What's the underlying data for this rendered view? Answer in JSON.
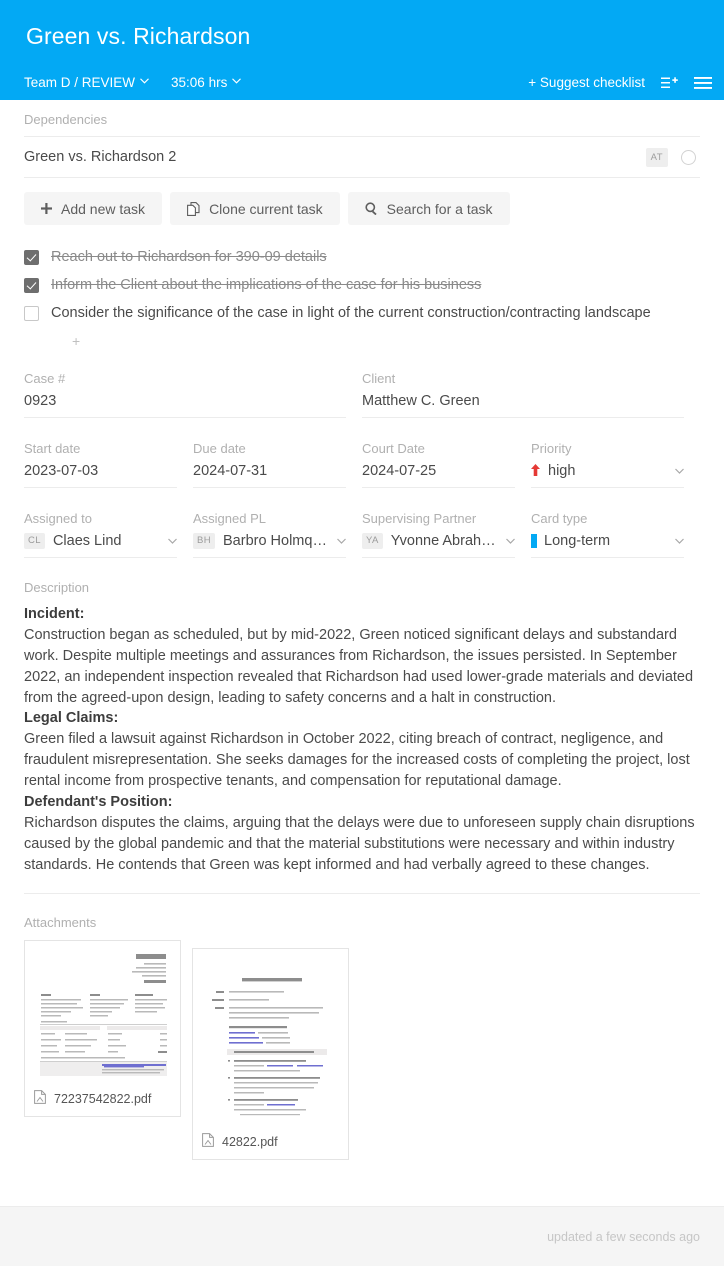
{
  "header": {
    "title": "Green vs. Richardson",
    "team_status": "Team D / REVIEW",
    "time_tracked": "35:06 hrs",
    "suggest_checklist": "+ Suggest checklist",
    "caret": "⌄",
    "brand_color": "#03a9f4"
  },
  "dependencies": {
    "label": "Dependencies",
    "items": [
      {
        "title": "Green vs. Richardson 2",
        "badge": "AT"
      }
    ]
  },
  "task_buttons": [
    {
      "label": "Add new task",
      "icon": "plus-icon"
    },
    {
      "label": "Clone current task",
      "icon": "clone-icon"
    },
    {
      "label": "Search for a task",
      "icon": "search-icon"
    }
  ],
  "checklist": {
    "add_label": "+",
    "items": [
      {
        "text": "Reach out to Richardson for 390-09 details",
        "checked": true
      },
      {
        "text": "Inform the Client about the implications of the case for his business",
        "checked": true
      },
      {
        "text": "Consider the significance of the case in light of the current construction/contracting landscape",
        "checked": false
      }
    ]
  },
  "fields": {
    "case_number": {
      "label": "Case #",
      "value": "0923"
    },
    "client": {
      "label": "Client",
      "value": "Matthew C. Green"
    },
    "start_date": {
      "label": "Start date",
      "value": "2023-07-03"
    },
    "due_date": {
      "label": "Due date",
      "value": "2024-07-31"
    },
    "court_date": {
      "label": "Court Date",
      "value": "2024-07-25"
    },
    "priority": {
      "label": "Priority",
      "value": "high",
      "color": "#e53935"
    },
    "assigned_to": {
      "label": "Assigned to",
      "value": "Claes Lind",
      "initials": "CL"
    },
    "assigned_pl": {
      "label": "Assigned PL",
      "value": "Barbro Holmqvist",
      "initials": "BH"
    },
    "supervising_partner": {
      "label": "Supervising Partner",
      "value": "Yvonne Abraha…",
      "initials": "YA"
    },
    "card_type": {
      "label": "Card type",
      "value": "Long-term",
      "color": "#03a9f4"
    }
  },
  "description": {
    "label": "Description",
    "blocks": [
      {
        "heading": "Incident:",
        "text": "Construction began as scheduled, but by mid-2022, Green noticed significant delays and substandard work. Despite multiple meetings and assurances from Richardson, the issues persisted. In September 2022, an independent inspection revealed that Richardson had used lower-grade materials and deviated from the agreed-upon design, leading to safety concerns and a halt in construction."
      },
      {
        "heading": "Legal Claims:",
        "text": "Green filed a lawsuit against Richardson in October 2022, citing breach of contract, negligence, and fraudulent misrepresentation. She seeks damages for the increased costs of completing the project, lost rental income from prospective tenants, and compensation for reputational damage."
      },
      {
        "heading": "Defendant's Position:",
        "text": "Richardson disputes the claims, arguing that the delays were due to unforeseen supply chain disruptions caused by the global pandemic and that the material substitutions were necessary and within industry standards. He contends that Green was kept informed and had verbally agreed to these changes."
      }
    ]
  },
  "attachments": {
    "label": "Attachments",
    "files": [
      {
        "name": "72237542822.pdf",
        "preview_title": "Invoice"
      },
      {
        "name": "42822.pdf",
        "preview_title": "Wsparcie dla Kanban Tool"
      }
    ]
  },
  "footer": {
    "updated_text": "updated a few seconds ago"
  }
}
